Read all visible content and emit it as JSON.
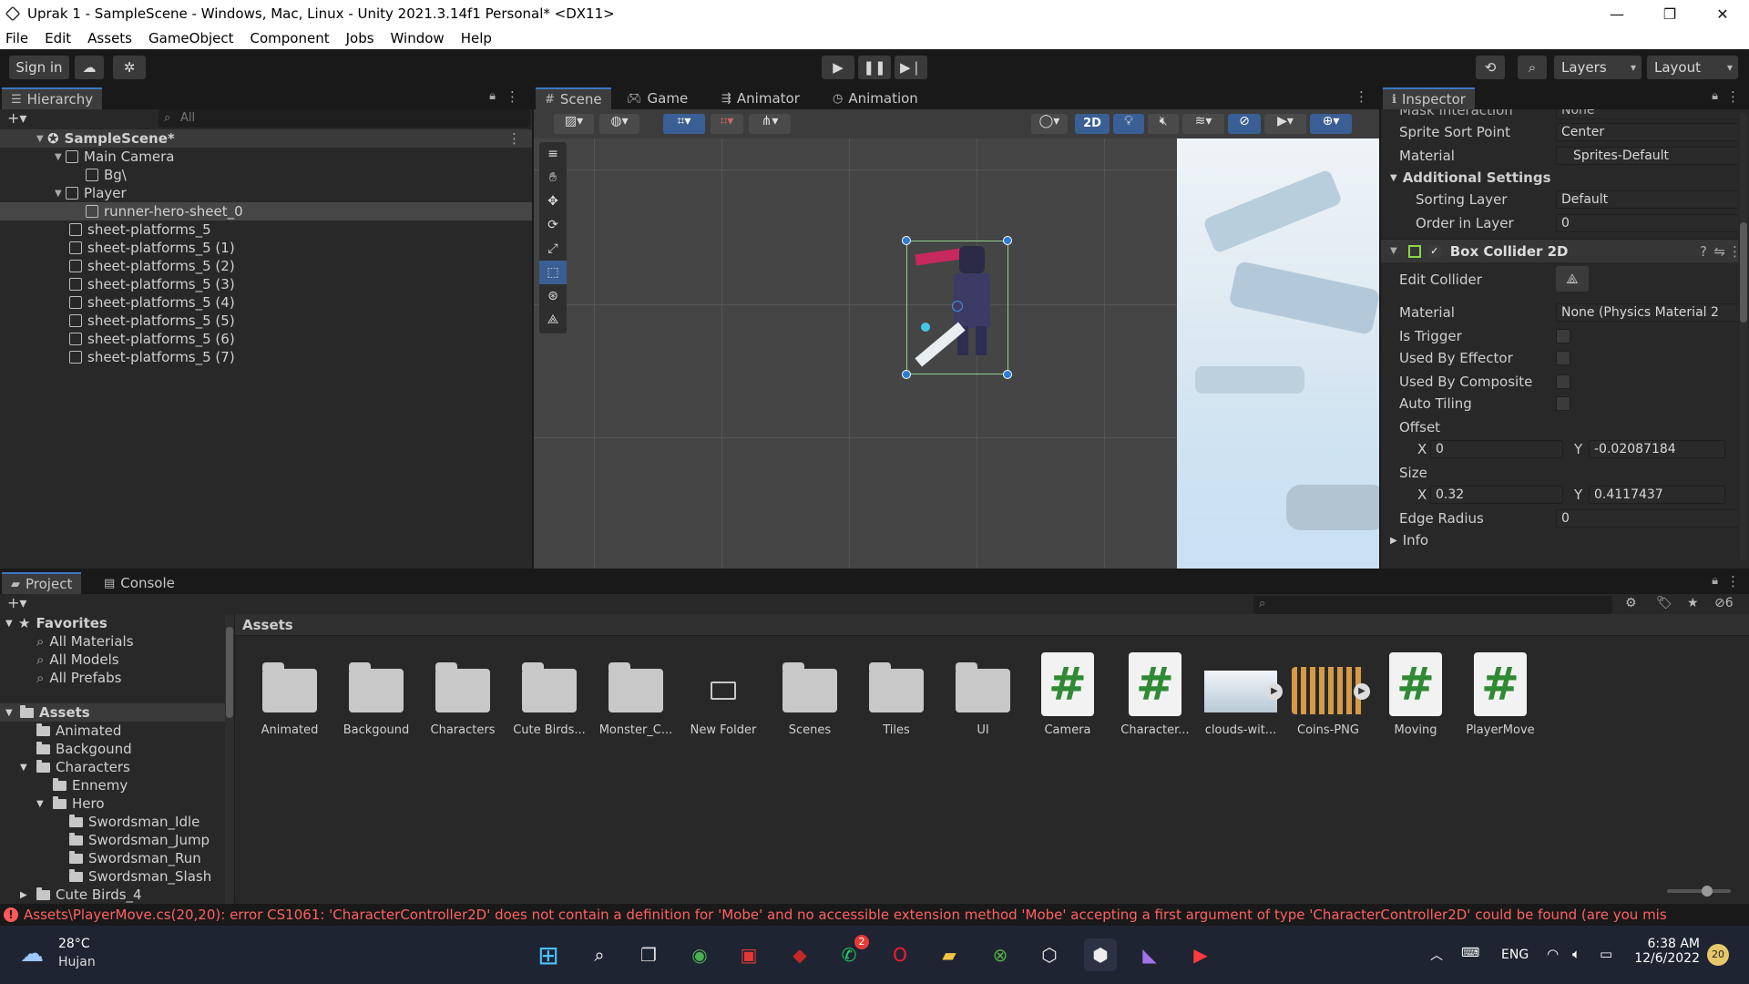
{
  "window": {
    "title": "Uprak 1 - SampleScene - Windows, Mac, Linux - Unity 2021.3.14f1 Personal* <DX11>",
    "minimize": "—",
    "restore": "❐",
    "close": "✕"
  },
  "menu": [
    "File",
    "Edit",
    "Assets",
    "GameObject",
    "Component",
    "Jobs",
    "Window",
    "Help"
  ],
  "toolbar": {
    "sign_in": "Sign in",
    "layers": "Layers",
    "layout": "Layout"
  },
  "hierarchy": {
    "tab": "Hierarchy",
    "search_placeholder": "All",
    "items": [
      {
        "label": "SampleScene*"
      },
      {
        "label": "Main Camera"
      },
      {
        "label": "Bg\\"
      },
      {
        "label": "Player"
      },
      {
        "label": "runner-hero-sheet_0"
      },
      {
        "label": "sheet-platforms_5"
      },
      {
        "label": "sheet-platforms_5 (1)"
      },
      {
        "label": "sheet-platforms_5 (2)"
      },
      {
        "label": "sheet-platforms_5 (3)"
      },
      {
        "label": "sheet-platforms_5 (4)"
      },
      {
        "label": "sheet-platforms_5 (5)"
      },
      {
        "label": "sheet-platforms_5 (6)"
      },
      {
        "label": "sheet-platforms_5 (7)"
      }
    ]
  },
  "scene": {
    "tabs": [
      "Scene",
      "Game",
      "Animator",
      "Animation"
    ],
    "mode_2d": "2D"
  },
  "inspector": {
    "tab": "Inspector",
    "cut_top": "Mask Interaction",
    "cut_top_value": "None",
    "sprite_sort_point": {
      "label": "Sprite Sort Point",
      "value": "Center"
    },
    "material": {
      "label": "Material",
      "value": "Sprites-Default"
    },
    "additional_settings": "Additional Settings",
    "sorting_layer": {
      "label": "Sorting Layer",
      "value": "Default"
    },
    "order_in_layer": {
      "label": "Order in Layer",
      "value": "0"
    },
    "box_collider": "Box Collider 2D",
    "edit_collider": "Edit Collider",
    "bc_material": {
      "label": "Material",
      "value": "None (Physics Material 2"
    },
    "is_trigger": "Is Trigger",
    "used_by_effector": "Used By Effector",
    "used_by_composite": "Used By Composite",
    "auto_tiling": "Auto Tiling",
    "offset": {
      "label": "Offset",
      "x_label": "X",
      "x": "0",
      "y_label": "Y",
      "y": "-0.02087184"
    },
    "size": {
      "label": "Size",
      "x_label": "X",
      "x": "0.32",
      "y_label": "Y",
      "y": "0.4117437"
    },
    "edge_radius": {
      "label": "Edge Radius",
      "value": "0"
    },
    "info": "Info"
  },
  "project": {
    "tabs": [
      "Project",
      "Console"
    ],
    "breadcrumb": "Assets",
    "hidden_count": "6",
    "tree": [
      {
        "label": "Favorites"
      },
      {
        "label": "All Materials"
      },
      {
        "label": "All Models"
      },
      {
        "label": "All Prefabs"
      },
      {
        "label": "Assets"
      },
      {
        "label": "Animated"
      },
      {
        "label": "Backgound"
      },
      {
        "label": "Characters"
      },
      {
        "label": "Ennemy"
      },
      {
        "label": "Hero"
      },
      {
        "label": "Swordsman_Idle"
      },
      {
        "label": "Swordsman_Jump"
      },
      {
        "label": "Swordsman_Run"
      },
      {
        "label": "Swordsman_Slash"
      },
      {
        "label": "Cute Birds_4"
      }
    ],
    "assets": [
      {
        "label": "Animated",
        "kind": "folder"
      },
      {
        "label": "Backgound",
        "kind": "folder"
      },
      {
        "label": "Characters",
        "kind": "folder"
      },
      {
        "label": "Cute Birds...",
        "kind": "folder"
      },
      {
        "label": "Monster_C...",
        "kind": "folder"
      },
      {
        "label": "New Folder",
        "kind": "empty-folder"
      },
      {
        "label": "Scenes",
        "kind": "folder"
      },
      {
        "label": "Tiles",
        "kind": "folder"
      },
      {
        "label": "UI",
        "kind": "folder"
      },
      {
        "label": "Camera",
        "kind": "script"
      },
      {
        "label": "Character...",
        "kind": "script"
      },
      {
        "label": "clouds-wit...",
        "kind": "image"
      },
      {
        "label": "Coins-PNG",
        "kind": "image"
      },
      {
        "label": "Moving",
        "kind": "script"
      },
      {
        "label": "PlayerMove",
        "kind": "script"
      }
    ]
  },
  "status": {
    "error": "Assets\\PlayerMove.cs(20,20): error CS1061: 'CharacterController2D' does not contain a definition for 'Mobe' and no accessible extension method 'Mobe' accepting a first argument of type 'CharacterController2D' could be found (are you mis"
  },
  "taskbar": {
    "weather_temp": "28°C",
    "weather_desc": "Hujan",
    "whatsapp_badge": "2",
    "lang": "ENG",
    "time": "6:38 AM",
    "date": "12/6/2022",
    "notif_count": "20"
  },
  "colors": {
    "accent": "#3a78c2",
    "error": "#ff6161",
    "script_green": "#2e8a33",
    "selection": "#3a5f94"
  }
}
